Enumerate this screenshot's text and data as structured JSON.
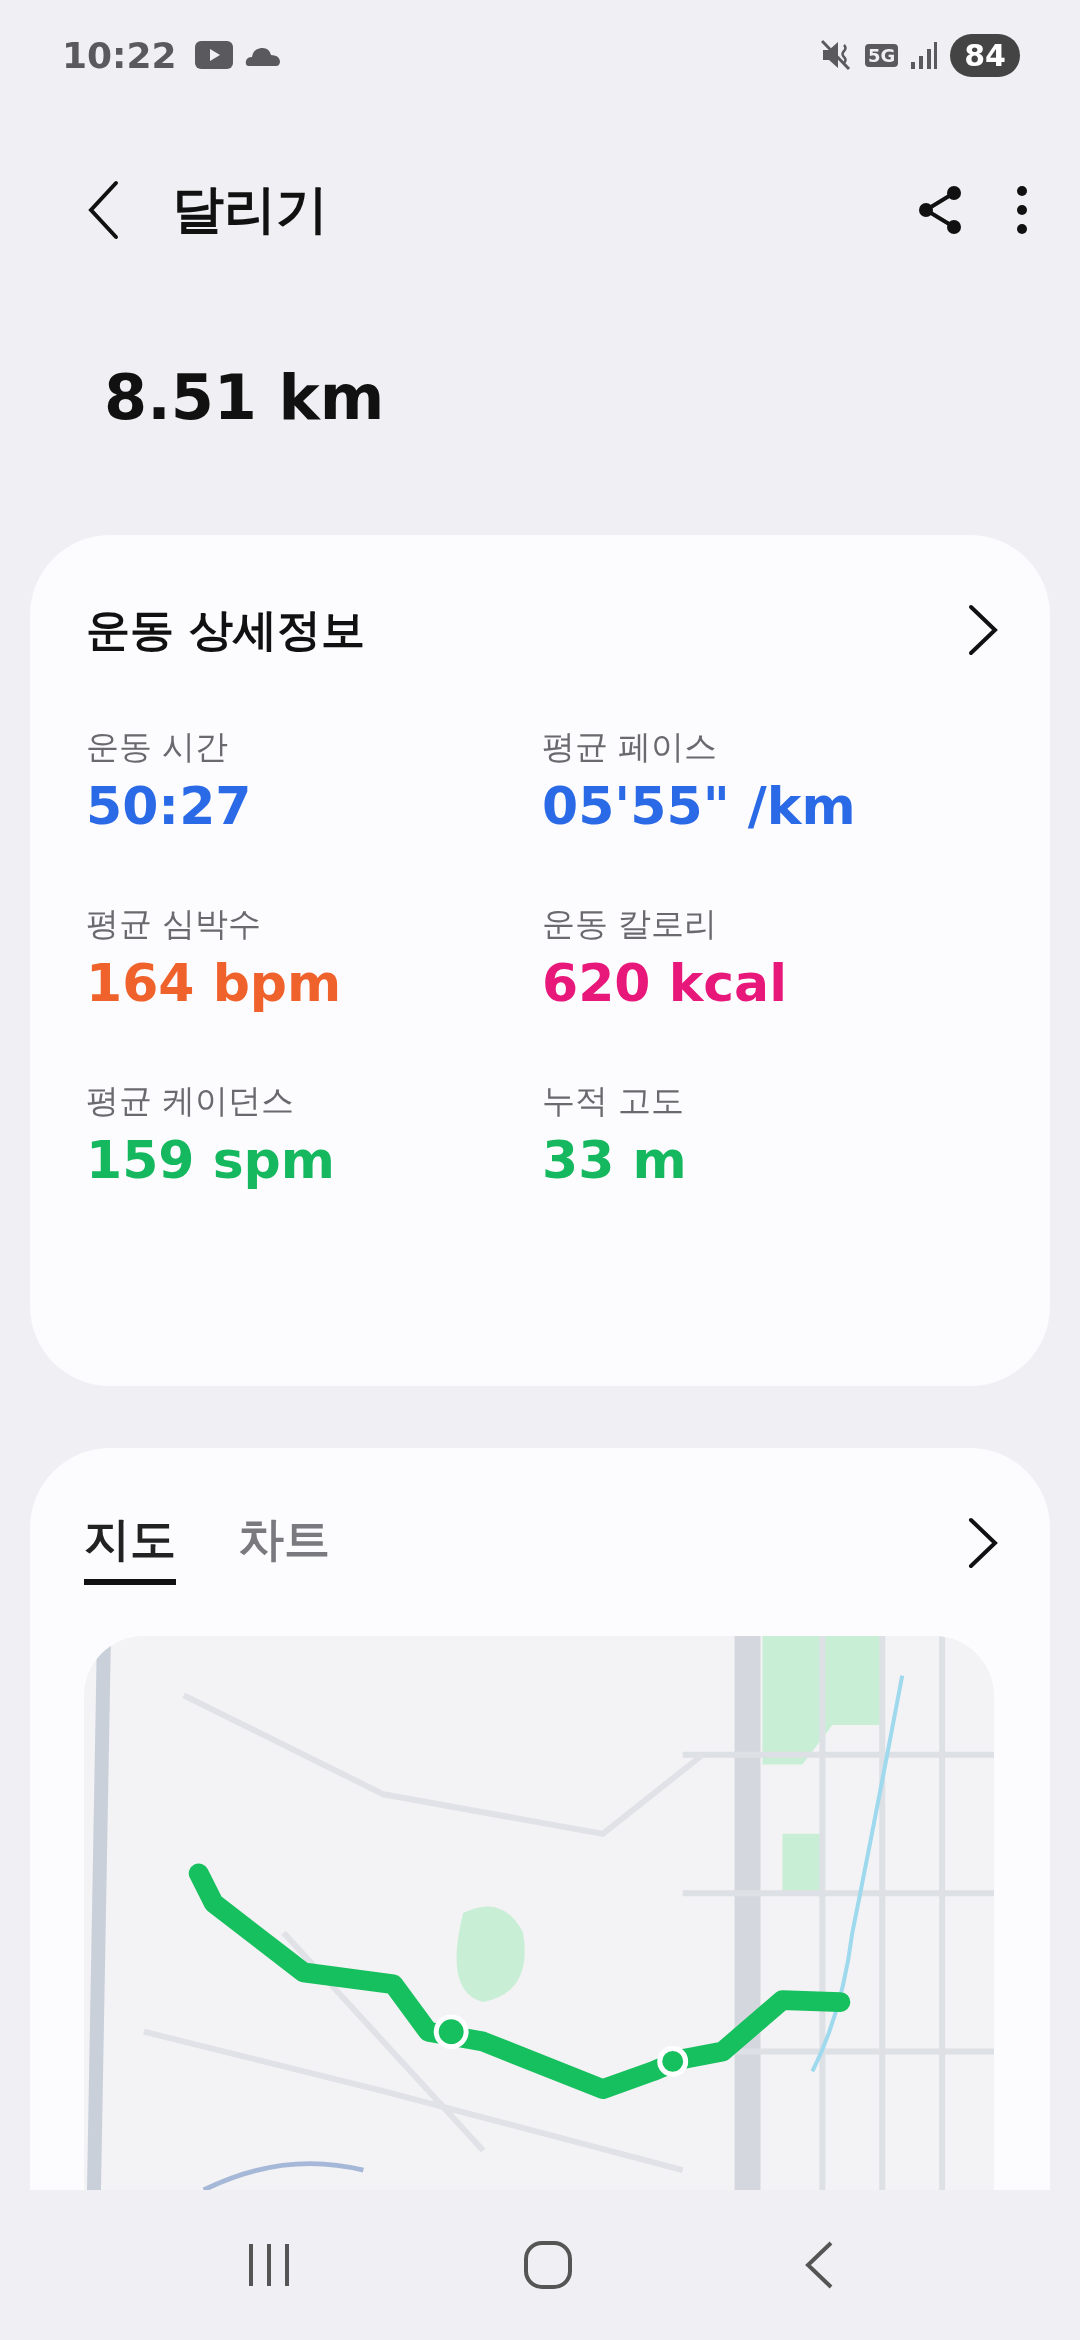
{
  "status_bar": {
    "time": "10:22",
    "network": "5G",
    "battery": "84"
  },
  "header": {
    "title": "달리기"
  },
  "distance": "8.51 km",
  "details": {
    "title": "운동 상세정보",
    "metrics": [
      {
        "label": "운동 시간",
        "value": "50:27",
        "color": "#2b6ae6"
      },
      {
        "label": "평균 페이스",
        "value": "05'55\" /km",
        "color": "#2b6ae6"
      },
      {
        "label": "평균 심박수",
        "value": "164 bpm",
        "color": "#f0622c"
      },
      {
        "label": "운동 칼로리",
        "value": "620 kcal",
        "color": "#e8177a"
      },
      {
        "label": "평균 케이던스",
        "value": "159 spm",
        "color": "#15b85e"
      },
      {
        "label": "누적 고도",
        "value": "33 m",
        "color": "#15b85e"
      }
    ]
  },
  "map_card": {
    "tabs": [
      {
        "label": "지도",
        "selected": true
      },
      {
        "label": "차트",
        "selected": false
      }
    ]
  }
}
